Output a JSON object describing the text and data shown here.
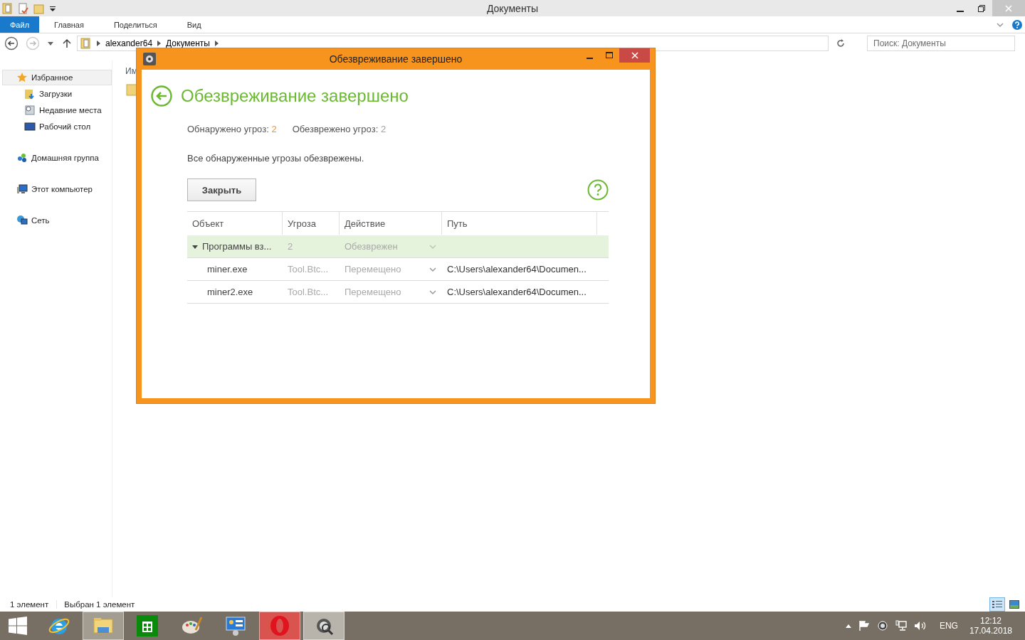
{
  "explorer": {
    "title": "Документы",
    "ribbon_tabs": [
      {
        "label": "Файл",
        "selected": true
      },
      {
        "label": "Главная",
        "selected": false
      },
      {
        "label": "Поделиться",
        "selected": false
      },
      {
        "label": "Вид",
        "selected": false
      }
    ],
    "address": {
      "crumbs": [
        "alexander64",
        "Документы"
      ]
    },
    "search": {
      "placeholder": "Поиск: Документы"
    },
    "nav": [
      {
        "label": "Избранное",
        "kind": "favorites",
        "selected": true,
        "children": [
          {
            "label": "Загрузки",
            "kind": "downloads",
            "selected": false
          },
          {
            "label": "Недавние места",
            "kind": "recent",
            "selected": false
          },
          {
            "label": "Рабочий стол",
            "kind": "desktop",
            "selected": false
          }
        ]
      },
      {
        "label": "Домашняя группа",
        "kind": "homegroup",
        "selected": false
      },
      {
        "label": "Этот компьютер",
        "kind": "computer",
        "selected": false
      },
      {
        "label": "Сеть",
        "kind": "network",
        "selected": false
      }
    ],
    "content": {
      "column_1": "Им"
    },
    "status_bar": [
      "1 элемент",
      "Выбран 1 элемент"
    ],
    "views": [
      {
        "kind": "details",
        "selected": true
      },
      {
        "kind": "large",
        "selected": false
      }
    ]
  },
  "dialog": {
    "title": "Обезвреживание завершено",
    "heading": "Обезвреживание завершено",
    "stats": [
      {
        "label": "Обнаружено угроз:",
        "value": "2",
        "color": "#f7941d"
      },
      {
        "label": "Обезврежено угроз:",
        "value": "2",
        "color": "#a0a0a0"
      }
    ],
    "message": "Все обнаруженные угрозы обезврежены.",
    "close_button": "Закрыть",
    "table": {
      "columns": [
        "Объект",
        "Угроза",
        "Действие",
        "Путь"
      ],
      "rows": [
        {
          "object": "Программы вз...",
          "threat": "2",
          "action": "Обезврежен",
          "expanded": true,
          "selected": true,
          "children": [
            {
              "object": "miner.exe",
              "threat": "Tool.Btc...",
              "action": "Перемещено",
              "path": "C:\\Users\\alexander64\\Documen...",
              "selected": false
            },
            {
              "object": "miner2.exe",
              "threat": "Tool.Btc...",
              "action": "Перемещено",
              "path": "C:\\Users\\alexander64\\Documen...",
              "selected": false
            }
          ]
        }
      ]
    }
  },
  "taskbar": {
    "apps": [
      {
        "kind": "ie",
        "running": false
      },
      {
        "kind": "explorer",
        "running": true,
        "color": "#a39c90"
      },
      {
        "kind": "store",
        "running": false
      },
      {
        "kind": "paint",
        "running": false
      },
      {
        "kind": "control",
        "running": false
      },
      {
        "kind": "opera",
        "running": true,
        "color": "#d9534f"
      },
      {
        "kind": "antivirus",
        "running": true,
        "color": "#b9b4ab"
      }
    ],
    "tray": {
      "language": "ENG",
      "time": "12:12",
      "date": "17.04.2018"
    }
  }
}
